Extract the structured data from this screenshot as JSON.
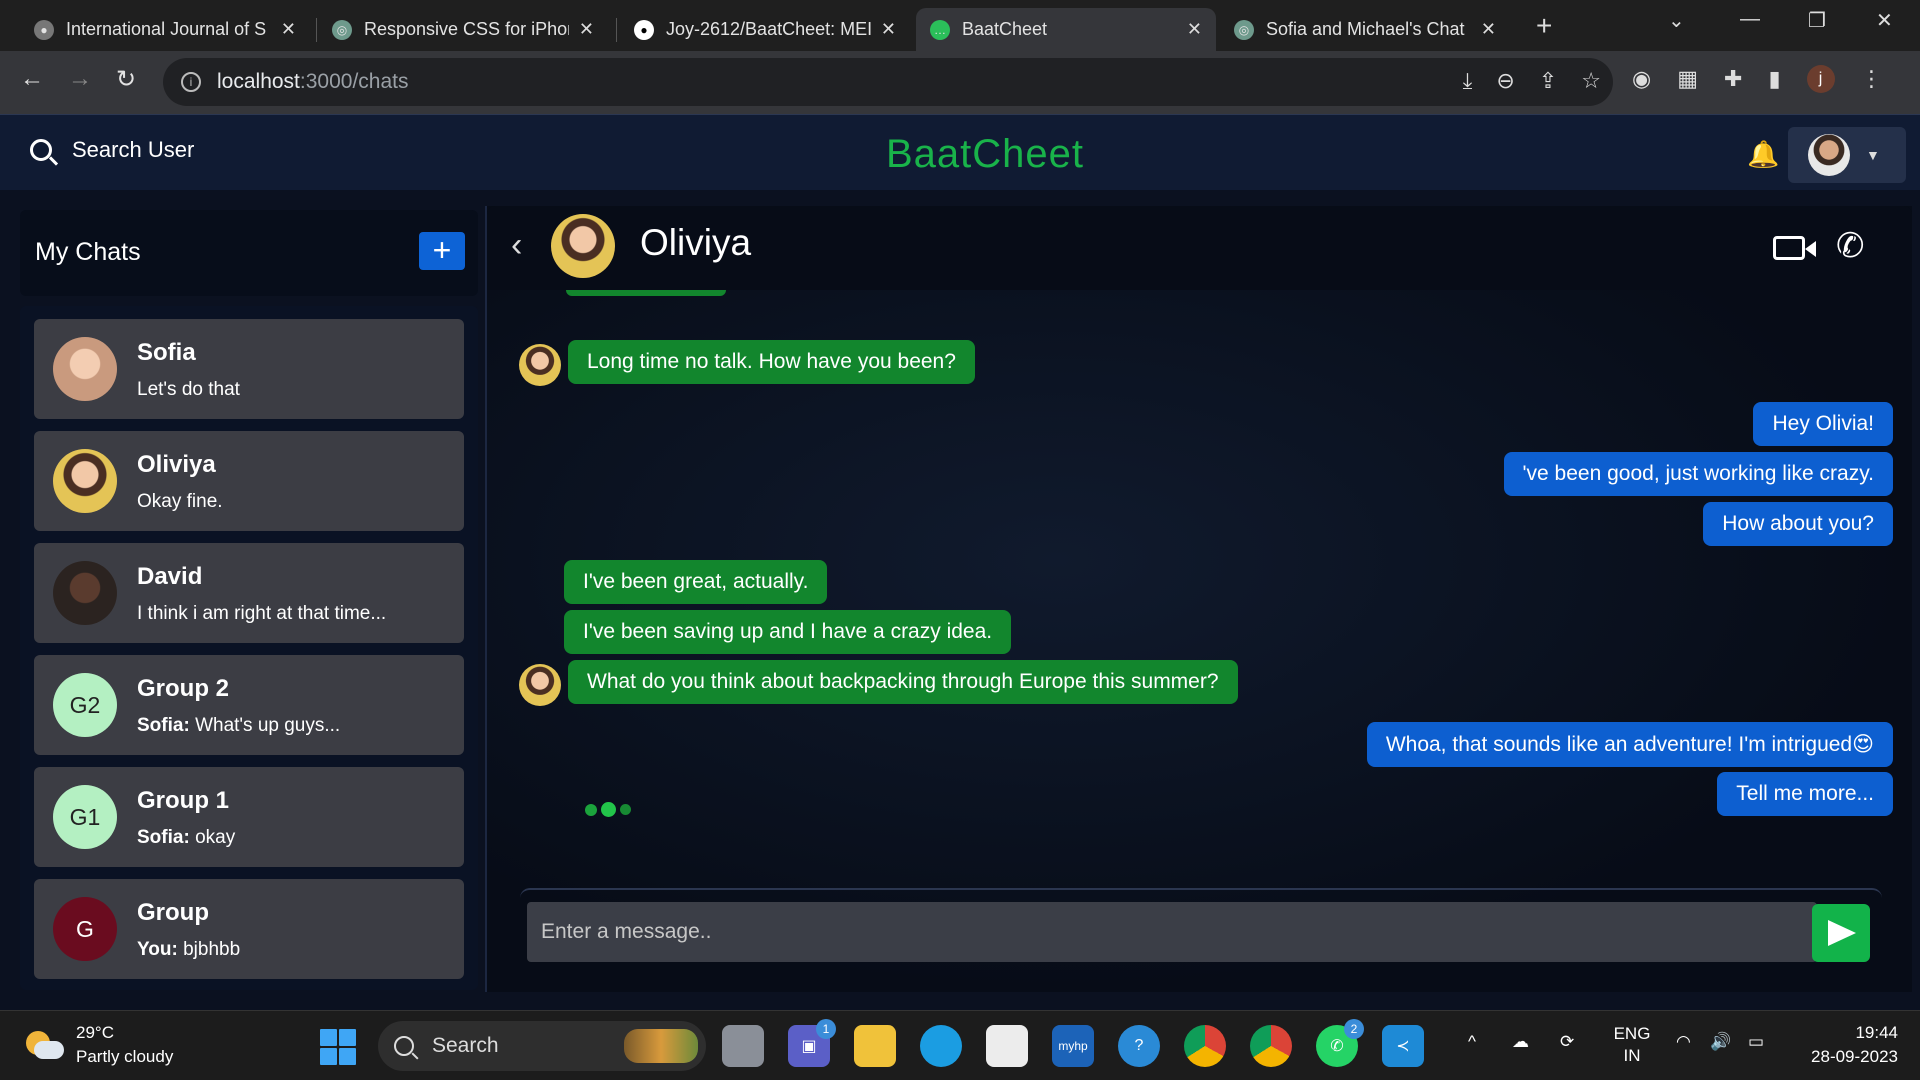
{
  "browser": {
    "tabs": [
      {
        "title": "International Journal of S",
        "active": false,
        "icon": "globe-icon"
      },
      {
        "title": "Responsive CSS for iPhon",
        "active": false,
        "icon": "chatgpt-icon"
      },
      {
        "title": "Joy-2612/BaatCheet: MEI",
        "active": false,
        "icon": "github-icon"
      },
      {
        "title": "BaatCheet",
        "active": true,
        "icon": "chat-app-icon"
      },
      {
        "title": "Sofia and Michael's Chat",
        "active": false,
        "icon": "chatgpt-icon"
      }
    ],
    "close_glyph": "✕",
    "new_tab_glyph": "+",
    "url_host": "localhost",
    "url_path": ":3000/chats",
    "profile_initial": "j"
  },
  "app": {
    "search_label": "Search User",
    "brand": "BaatCheet",
    "brand_color": "#19b34a"
  },
  "sidebar": {
    "title": "My Chats",
    "add_glyph": "+",
    "chats": [
      {
        "name": "Sofia",
        "sender": "",
        "preview": "Let's do that",
        "avatar_text": "",
        "avatar_color": "#c99a7e"
      },
      {
        "name": "Oliviya",
        "sender": "",
        "preview": "Okay fine.",
        "avatar_text": "",
        "avatar_color": "#e4c456"
      },
      {
        "name": "David",
        "sender": "",
        "preview": "I think i am right at that time...",
        "avatar_text": "",
        "avatar_color": "#4a3a36"
      },
      {
        "name": "Group 2",
        "sender": "Sofia:",
        "preview": "What's up guys...",
        "avatar_text": "G2",
        "avatar_color": "#b4f0c2"
      },
      {
        "name": "Group 1",
        "sender": "Sofia:",
        "preview": "okay",
        "avatar_text": "G1",
        "avatar_color": "#b4f0c2"
      },
      {
        "name": "Group",
        "sender": "You:",
        "preview": "bjbhbb",
        "avatar_text": "G",
        "avatar_color": "#6a0c1f"
      }
    ]
  },
  "chat": {
    "contact_name": "Oliviya",
    "messages": [
      {
        "dir": "in",
        "text": "Long time no talk. How have you been?",
        "avatar": true
      },
      {
        "dir": "out",
        "text": "Hey Olivia!"
      },
      {
        "dir": "out",
        "text": "'ve been good, just working like crazy."
      },
      {
        "dir": "out",
        "text": "How about you?"
      },
      {
        "dir": "in",
        "text": "I've been great, actually.",
        "avatar": false
      },
      {
        "dir": "in",
        "text": "I've been saving up and I have a crazy idea.",
        "avatar": false
      },
      {
        "dir": "in",
        "text": "What do you think about backpacking through Europe this summer?",
        "avatar": true
      },
      {
        "dir": "out",
        "text": "Whoa, that sounds like an adventure! I'm intrigued😍"
      },
      {
        "dir": "out",
        "text": "Tell me more..."
      }
    ],
    "input_placeholder": "Enter a message..",
    "incoming_color": "#12862d",
    "outgoing_color": "#0d5fd0"
  },
  "taskbar": {
    "temperature": "29°C",
    "weather": "Partly cloudy",
    "search_label": "Search",
    "teams_badge": "1",
    "whatsapp_badge": "2",
    "language": "ENG",
    "region": "IN",
    "time": "19:44",
    "date": "28-09-2023"
  }
}
